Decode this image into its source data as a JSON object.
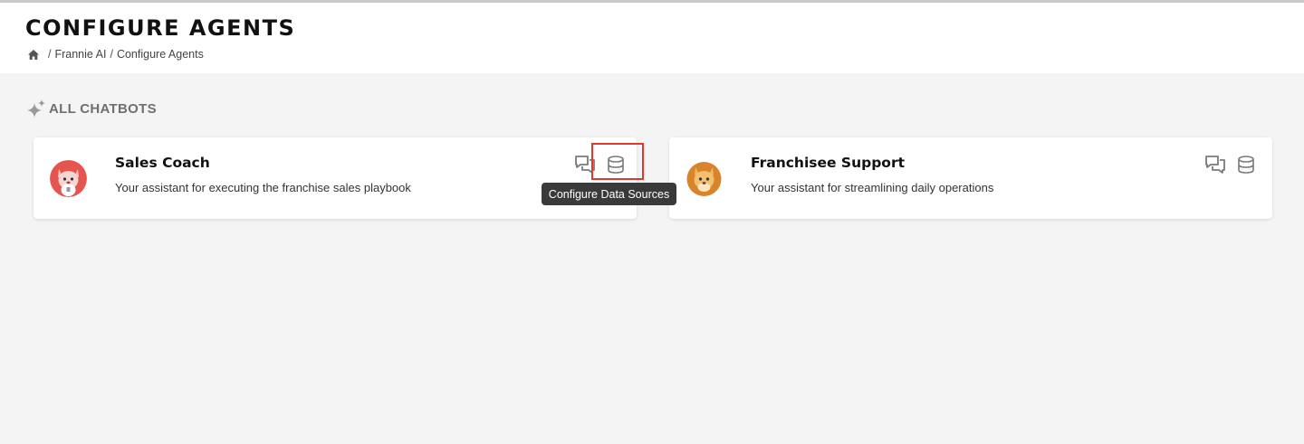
{
  "header": {
    "title": "CONFIGURE AGENTS",
    "breadcrumb": {
      "home_icon": "home-icon",
      "separator": "/",
      "items": [
        "Frannie AI",
        "Configure Agents"
      ]
    }
  },
  "section": {
    "icon": "sparkle-icon",
    "title": "ALL CHATBOTS"
  },
  "cards": [
    {
      "title": "Sales Coach",
      "description": "Your assistant for executing the franchise sales playbook",
      "avatar": "fox-mascot-avatar",
      "avatar_color": "#e5544e",
      "actions": [
        "chat-icon",
        "database-icon"
      ]
    },
    {
      "title": "Franchisee Support",
      "description": "Your assistant for streamlining daily operations",
      "avatar": "lion-mascot-avatar",
      "avatar_color": "#d9842b",
      "actions": [
        "chat-icon",
        "database-icon"
      ]
    }
  ],
  "tooltip": {
    "text": "Configure Data Sources"
  },
  "colors": {
    "highlight": "#e0382c",
    "background": "#f4f4f4",
    "icon_gray": "#7a7a7a"
  }
}
